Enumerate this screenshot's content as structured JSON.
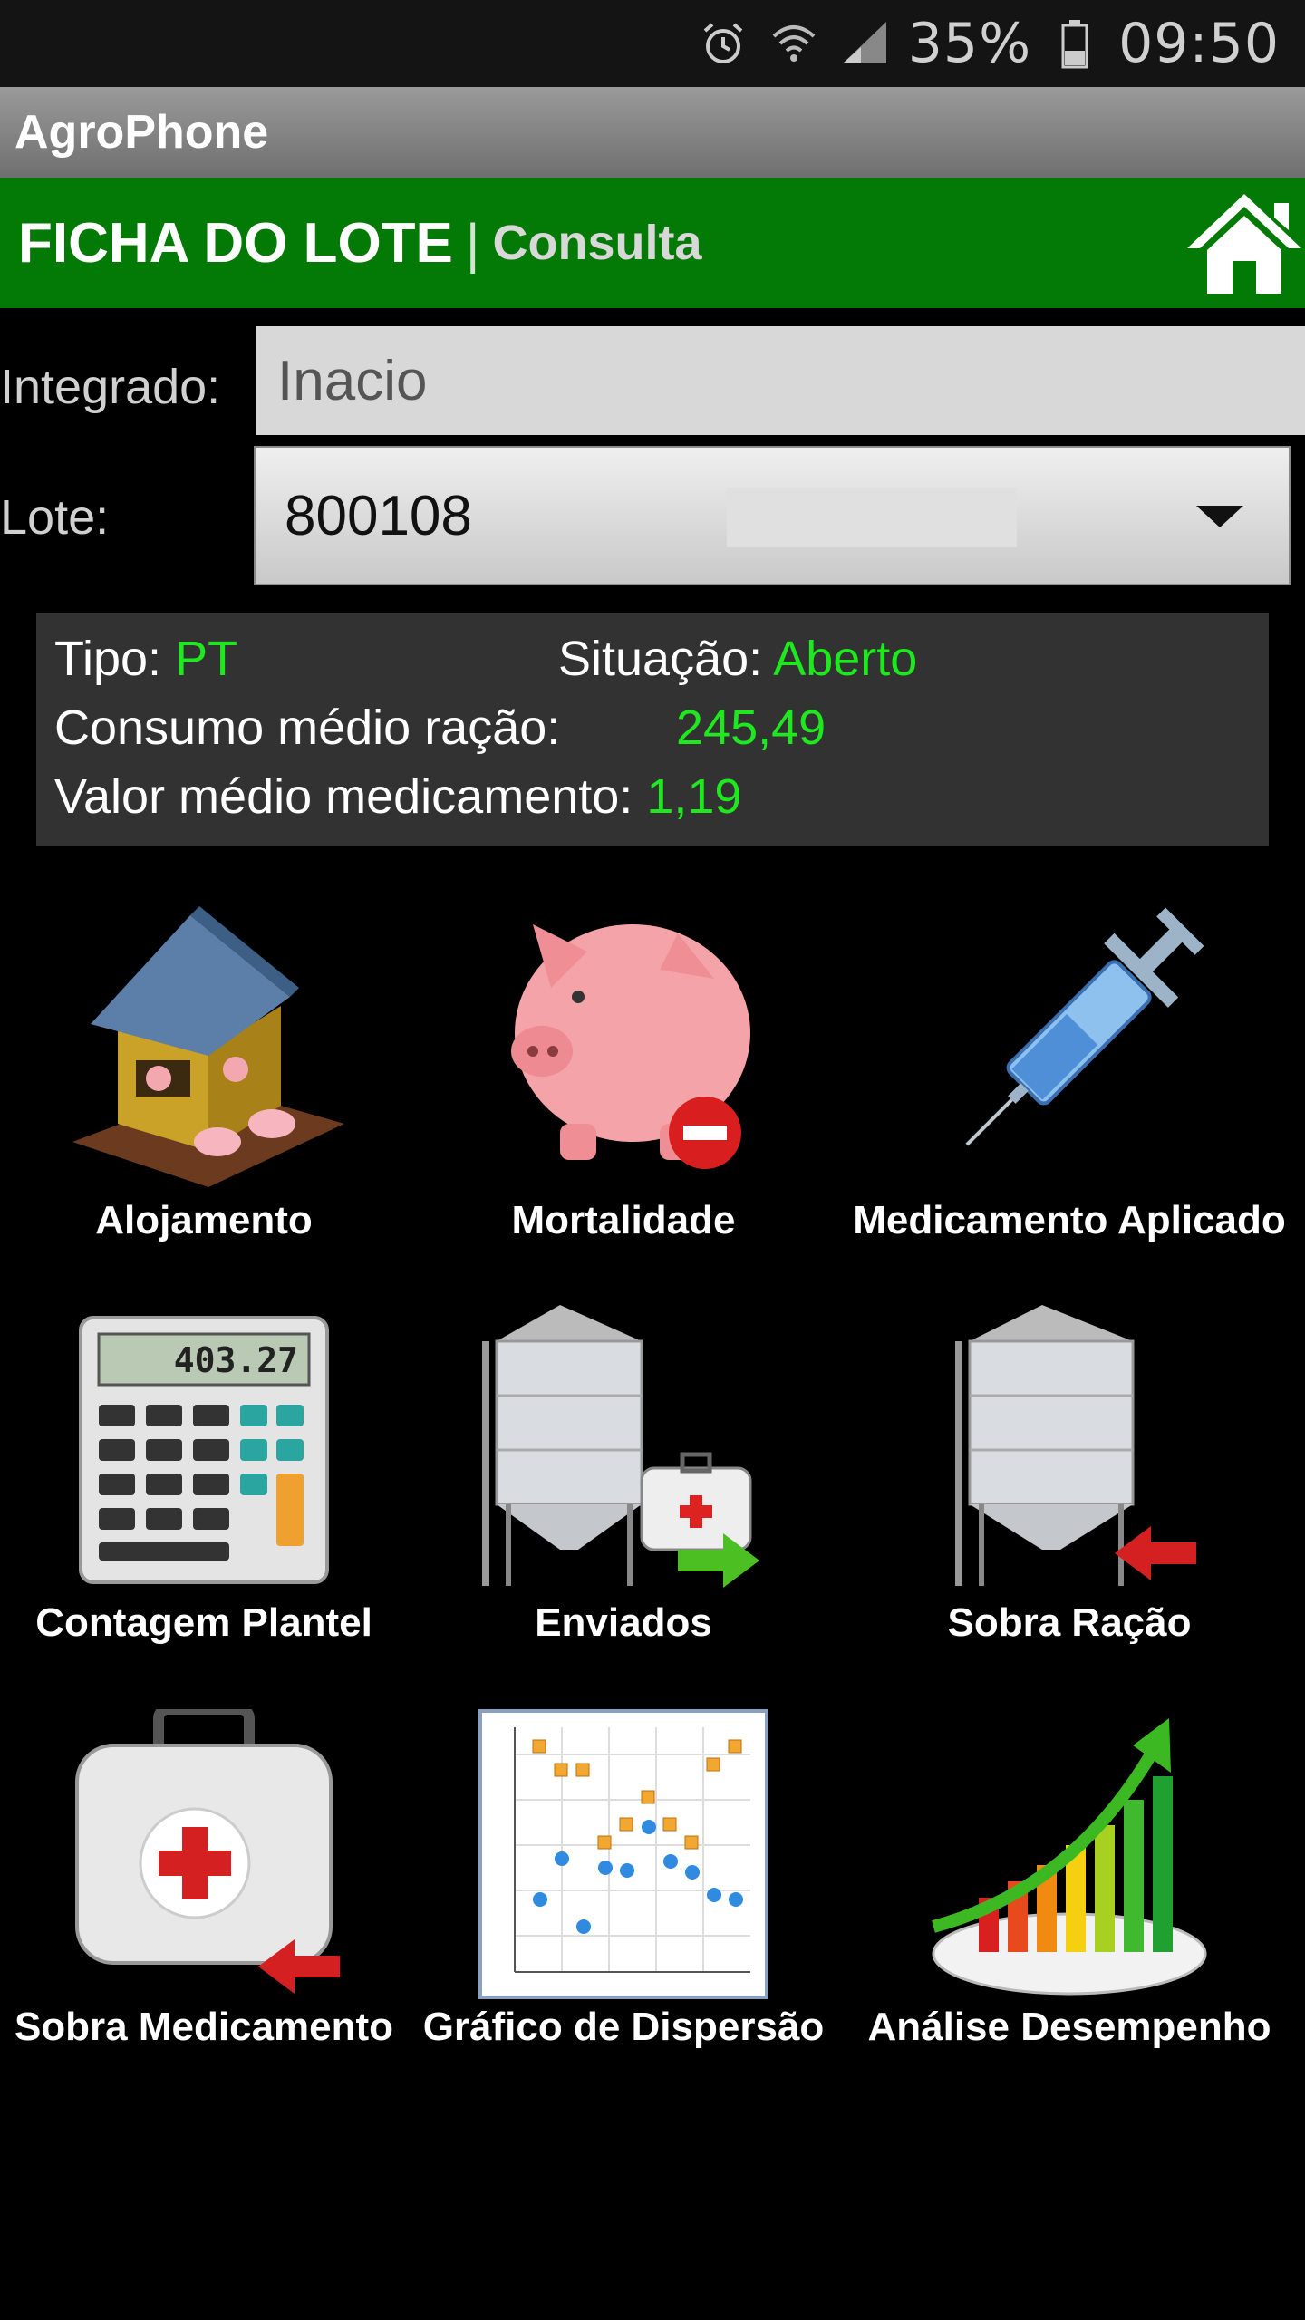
{
  "status_bar": {
    "icons": [
      "alarm-clock-icon",
      "wifi-icon",
      "signal-icon",
      "battery-icon"
    ],
    "battery": "35%",
    "time": "09:50"
  },
  "app": {
    "title": "AgroPhone"
  },
  "header": {
    "title": "FICHA DO LOTE",
    "separator": "|",
    "subtitle": "Consulta",
    "home_icon": "home-icon",
    "color": "#047a06"
  },
  "form": {
    "integrado_label": "Integrado:",
    "integrado_value": "Inacio",
    "lote_label": "Lote:",
    "lote_value": "800108"
  },
  "info": {
    "tipo_label": "Tipo:",
    "tipo_value": "PT",
    "situacao_label": "Situação:",
    "situacao_value": "Aberto",
    "consumo_label": "Consumo médio ração:",
    "consumo_value": "245,49",
    "valor_label": "Valor médio medicamento:",
    "valor_value": "1,19",
    "value_color": "#1ee81e"
  },
  "tiles": [
    {
      "label": "Alojamento",
      "icon": "barn-pigs-icon"
    },
    {
      "label": "Mortalidade",
      "icon": "piggy-minus-icon"
    },
    {
      "label": "Medicamento Aplicado",
      "icon": "syringe-icon"
    },
    {
      "label": "Contagem Plantel",
      "icon": "calculator-icon",
      "display": "403.27"
    },
    {
      "label": "Enviados",
      "icon": "silo-send-icon"
    },
    {
      "label": "Sobra Ração",
      "icon": "silo-return-icon"
    },
    {
      "label": "Sobra Medicamento",
      "icon": "medkit-return-icon"
    },
    {
      "label": "Gráfico de Dispersão",
      "icon": "scatter-chart-icon"
    },
    {
      "label": "Análise Desempenho",
      "icon": "growth-chart-icon"
    }
  ]
}
